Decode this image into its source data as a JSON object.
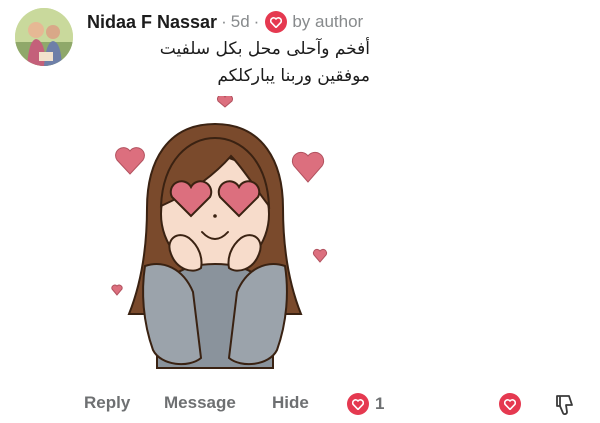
{
  "comment": {
    "author_name": "Nidaa F Nassar",
    "separator": "·",
    "timestamp": "5d",
    "author_badge_icon": "heart-icon",
    "author_badge_text": "by author",
    "text_lines": [
      "أفخم وآحلى محل بكل سلفيت",
      "موفقين وربنا يباركلكم"
    ],
    "sticker_icon": "girl-heart-eyes-sticker"
  },
  "actions": {
    "reply_label": "Reply",
    "message_label": "Message",
    "hide_label": "Hide",
    "like_count": "1",
    "react_icon": "heart-icon",
    "dislike_icon": "thumbs-down-icon"
  },
  "colors": {
    "accent_red": "#e53950",
    "muted_text": "#878a8c",
    "action_text": "#6e7072",
    "sticker_heart": "#dc6f7e"
  }
}
